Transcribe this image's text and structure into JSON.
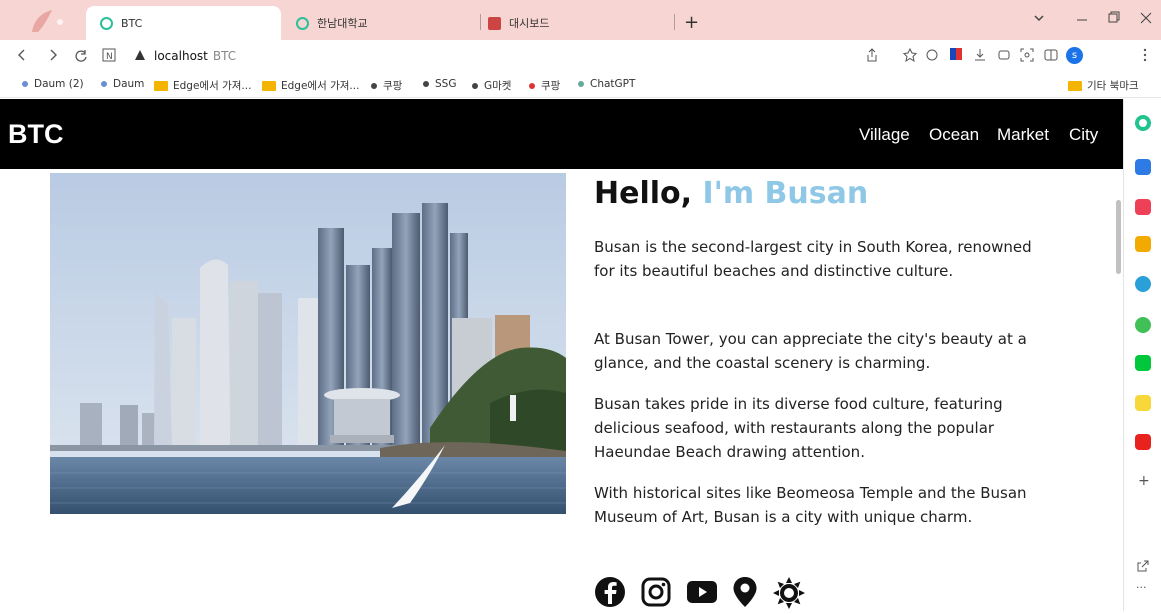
{
  "tabs": [
    {
      "label": "BTC",
      "active": true
    },
    {
      "label": "한남대학교",
      "active": false
    },
    {
      "label": "대시보드",
      "active": false
    }
  ],
  "new_tab_label": "+",
  "address": {
    "host": "localhost",
    "page_title": "BTC"
  },
  "bookmarks": [
    {
      "label": "Daum (2)",
      "kind": "dot",
      "color": "#6b8fd6"
    },
    {
      "label": "Daum",
      "kind": "dot",
      "color": "#6b8fd6"
    },
    {
      "label": "Edge에서 가져...",
      "kind": "folder"
    },
    {
      "label": "Edge에서 가져...",
      "kind": "folder"
    },
    {
      "label": "쿠팡",
      "kind": "dot",
      "color": "#444"
    },
    {
      "label": "SSG",
      "kind": "dot",
      "color": "#444"
    },
    {
      "label": "G마켓",
      "kind": "dot",
      "color": "#444"
    },
    {
      "label": "쿠팡",
      "kind": "dot",
      "color": "#d33"
    },
    {
      "label": "ChatGPT",
      "kind": "dot",
      "color": "#6a9"
    }
  ],
  "other_bookmarks": "기타 북마크",
  "site": {
    "logo": "BTC",
    "nav": [
      "Village",
      "Ocean",
      "Market",
      "City"
    ],
    "heading_prefix": "Hello,",
    "heading_highlight": "I'm Busan",
    "paragraphs": [
      "Busan is the second-largest city in South Korea, renowned for its beautiful beaches and distinctive culture.",
      "At Busan Tower, you can appreciate the city's beauty at a glance, and the coastal scenery is charming.",
      "Busan takes pride in its diverse food culture, featuring delicious seafood, with restaurants along the popular Haeundae Beach drawing attention.",
      "With historical sites like Beomeosa Temple and the Busan Museum of Art, Busan is a city with unique charm."
    ],
    "social_icons": [
      "facebook-icon",
      "instagram-icon",
      "youtube-icon",
      "map-pin-icon",
      "sun-icon"
    ]
  },
  "profile_initial": "s",
  "colors": {
    "accent": "#8fc8e6",
    "nav_bg": "#000000",
    "tab_strip": "#f7d5d2"
  }
}
